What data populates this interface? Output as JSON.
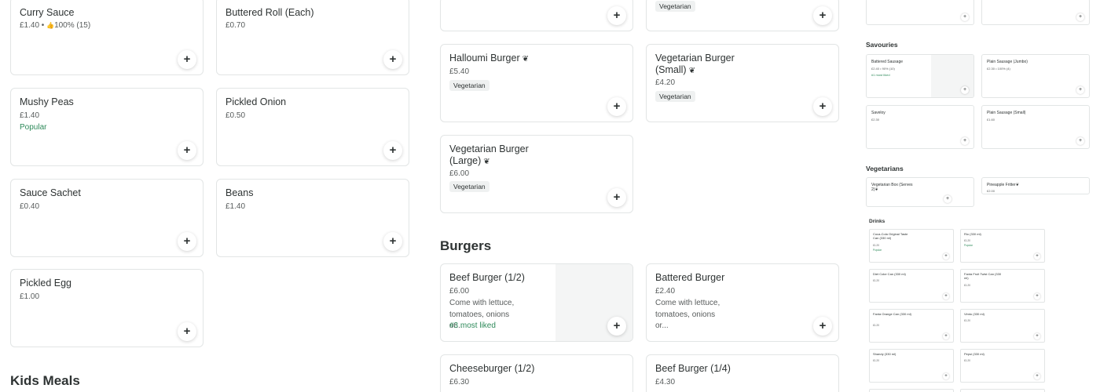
{
  "left_column": {
    "items": [
      {
        "name": "Curry Sauce",
        "price": "£1.40 •",
        "rating": "100% (15)"
      },
      {
        "name": "Buttered Roll (Each)",
        "price": "£0.70"
      },
      {
        "name": "Mushy Peas",
        "price": "£1.40",
        "note": "Popular"
      },
      {
        "name": "Pickled Onion",
        "price": "£0.50"
      },
      {
        "name": "Sauce Sachet",
        "price": "£0.40"
      },
      {
        "name": "Beans",
        "price": "£1.40"
      },
      {
        "name": "Pickled Egg",
        "price": "£1.00"
      }
    ]
  },
  "kids_meals": {
    "title": "Kids Meals"
  },
  "middle_column": {
    "top_tag": "Vegetarian",
    "items": [
      {
        "name": "Halloumi Burger",
        "price": "£5.40",
        "tag": "Vegetarian"
      },
      {
        "name": "Vegetarian Burger (Small)",
        "price": "£4.20",
        "tag": "Vegetarian"
      },
      {
        "name": "Vegetarian Burger (Large)",
        "price": "£6.00",
        "tag": "Vegetarian"
      }
    ]
  },
  "burgers": {
    "title": "Burgers",
    "items": [
      {
        "name": "Beef Burger (1/2)",
        "price": "£6.00",
        "desc": "Come with lettuce, tomatoes, onions or...",
        "note": "#3 most liked"
      },
      {
        "name": "Battered Burger",
        "price": "£2.40",
        "desc": "Come with lettuce, tomatoes, onions or..."
      },
      {
        "name": "Cheeseburger (1/2)",
        "price": "£6.30"
      },
      {
        "name": "Beef Burger (1/4)",
        "price": "£4.30"
      }
    ]
  },
  "mini_panel": {
    "savouries_title": "Savouries",
    "savouries": [
      {
        "name": "Battered Sausage",
        "price": "£2.40 • 90% (10)",
        "note": "#1 most liked"
      },
      {
        "name": "Plain Sausage (Jumbo)",
        "price": "£2.30 • 100% (4)"
      },
      {
        "name": "Saveloy",
        "price": "£2.30"
      },
      {
        "name": "Plain Sausage (Small)",
        "price": "£1.60"
      }
    ],
    "vegetarians_title": "Vegetarians",
    "vegetarians": [
      {
        "name": "Vegetarian Box (Serves 2)"
      },
      {
        "name": "Pineapple Fritter",
        "price": "£2.00"
      }
    ],
    "drinks_title": "Drinks",
    "drinks": [
      {
        "name": "Coca-Cola Original Taste Can (330 ml)",
        "price": "£1.20",
        "note": "Popular"
      },
      {
        "name": "Rio (330 ml)",
        "price": "£1.20",
        "note": "Popular"
      },
      {
        "name": "Diet Coke Can (330 ml)",
        "price": "£1.20"
      },
      {
        "name": "Fanta Fruit Twist Can (330 ml)",
        "price": "£1.20"
      },
      {
        "name": "Fanta Orange Can (330 ml)",
        "price": "£1.20"
      },
      {
        "name": "Vimto (330 ml)",
        "price": "£1.20"
      },
      {
        "name": "Shandy (330 ml)",
        "price": "£1.20"
      },
      {
        "name": "Pepsi (330 ml)",
        "price": "£1.20"
      }
    ]
  },
  "icons": {
    "add": "+",
    "leaf": "❦",
    "thumb": "👍"
  },
  "colors": {
    "accent": "#2e8a5a",
    "text": "#2e3333",
    "border": "#e2e5e5"
  }
}
